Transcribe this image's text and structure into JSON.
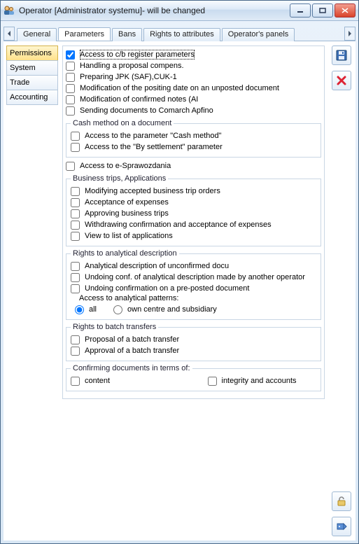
{
  "window": {
    "title": "Operator [Administrator systemu]- will be changed"
  },
  "tabs": {
    "general": "General",
    "parameters": "Parameters",
    "bans": "Bans",
    "rights_attr": "Rights to attributes",
    "op_panels": "Operator's panels"
  },
  "sidebar": {
    "permissions": "Permissions",
    "system": "System",
    "trade": "Trade",
    "accounting": "Accounting"
  },
  "panel": {
    "cb_register": "Access to c/b register parameters",
    "proposal_compens": "Handling a proposal compens.",
    "jpk_saf": "Preparing JPK (SAF),CUK-1",
    "mod_posting_date": "Modification of the positing date on an unposted document",
    "mod_confirmed_notes": "Modification of confirmed notes (AI",
    "send_apfino": "Sending documents to Comarch Apfino",
    "group_cash": "Cash method on a document",
    "access_cash_param": "Access to the parameter \"Cash method\"",
    "access_by_settlement": "Access to the \"By settlement\" parameter",
    "e_sprawozdania": "Access to e-Sprawozdania",
    "group_trips": "Business trips, Applications",
    "trip_modify": "Modifying accepted business trip orders",
    "trip_accept_exp": "Acceptance of expenses",
    "trip_approve": "Approving business trips",
    "trip_withdraw": "Withdrawing confirmation and acceptance of expenses",
    "trip_view_list": "View to list of applications",
    "group_analytical": "Rights to analytical description",
    "anal_unconfirmed": "Analytical description of unconfirmed docu",
    "anal_undo_other": "Undoing conf. of analytical description made by another operator",
    "anal_undo_preposted": "Undoing confirmation on a pre-posted document",
    "anal_access_patterns": "Access to analytical patterns:",
    "radio_all": "all",
    "radio_own": "own centre and subsidiary",
    "group_batch": "Rights to batch transfers",
    "batch_proposal": "Proposal of a batch transfer",
    "batch_approval": "Approval of a batch transfer",
    "group_confirm": "Confirming documents in terms of:",
    "confirm_content": "content",
    "confirm_integrity": "integrity and accounts"
  }
}
